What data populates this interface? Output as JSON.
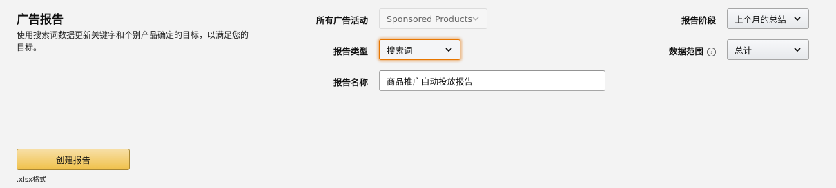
{
  "left": {
    "title": "广告报告",
    "description": "使用搜索词数据更新关键字和个别产品确定的目标，以满足您的目标。"
  },
  "form": {
    "campaigns": {
      "label": "所有广告活动",
      "value": "Sponsored Products"
    },
    "report_type": {
      "label": "报告类型",
      "value": "搜索词"
    },
    "report_name": {
      "label": "报告名称",
      "value": "商品推广自动投放报告"
    },
    "report_period": {
      "label": "报告阶段",
      "value": "上个月的总结"
    },
    "data_range": {
      "label": "数据范围",
      "help": "?",
      "value": "总计"
    }
  },
  "actions": {
    "create_label": "创建报告",
    "format_note": ".xlsx格式"
  },
  "colors": {
    "focus": "#e77600",
    "primary_button": "#f0c14b",
    "background": "#f3f3f3"
  }
}
